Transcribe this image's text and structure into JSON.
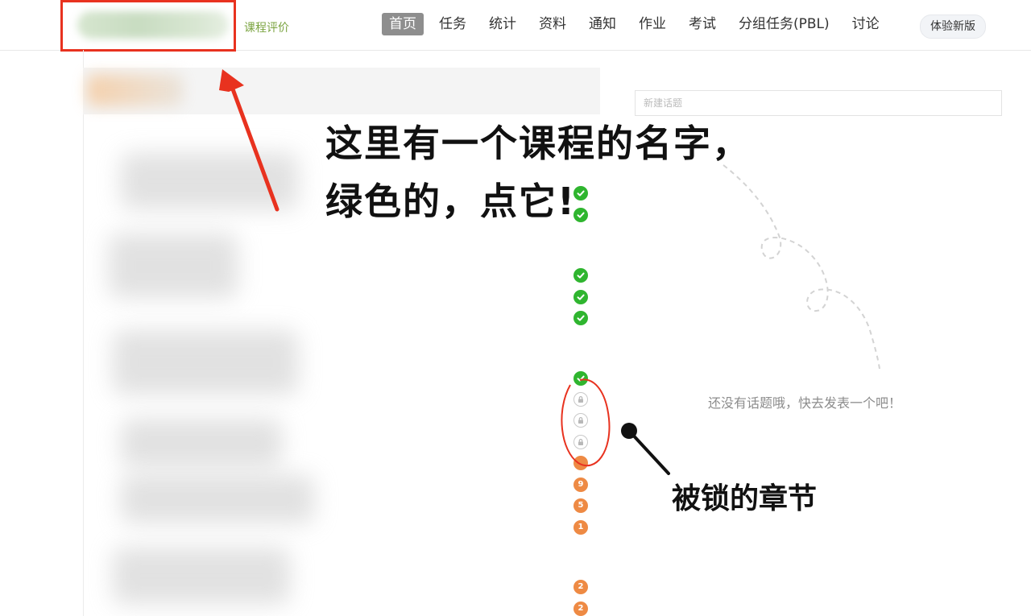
{
  "header": {
    "course_eval": "课程评价",
    "nav": [
      "首页",
      "任务",
      "统计",
      "资料",
      "通知",
      "作业",
      "考试",
      "分组任务(PBL)",
      "讨论"
    ],
    "active_nav": "首页",
    "new_version": "体验新版"
  },
  "chapters": {
    "status_icons": [
      {
        "type": "done"
      },
      {
        "type": "done"
      },
      {
        "type": "done"
      },
      {
        "type": "done"
      },
      {
        "type": "done"
      },
      {
        "type": "done"
      },
      {
        "type": "locked"
      },
      {
        "type": "locked"
      },
      {
        "type": "locked"
      },
      {
        "type": "count",
        "label": ""
      },
      {
        "type": "count",
        "label": "9"
      },
      {
        "type": "count",
        "label": "5"
      },
      {
        "type": "count",
        "label": "1"
      },
      {
        "type": "count",
        "label": "2"
      },
      {
        "type": "count",
        "label": "2"
      }
    ]
  },
  "discussion": {
    "topic_placeholder": "新建话题",
    "empty_text": "还没有话题哦，快去发表一个吧！"
  },
  "annotations": {
    "line1": "这里有一个课程的名字，",
    "line2": "绿色的，点它!",
    "locked_label": "被锁的章节"
  },
  "colors": {
    "highlight": "#e8321f",
    "done": "#2fb52f",
    "count": "#ee8a44",
    "course_eval": "#7aa33f"
  }
}
